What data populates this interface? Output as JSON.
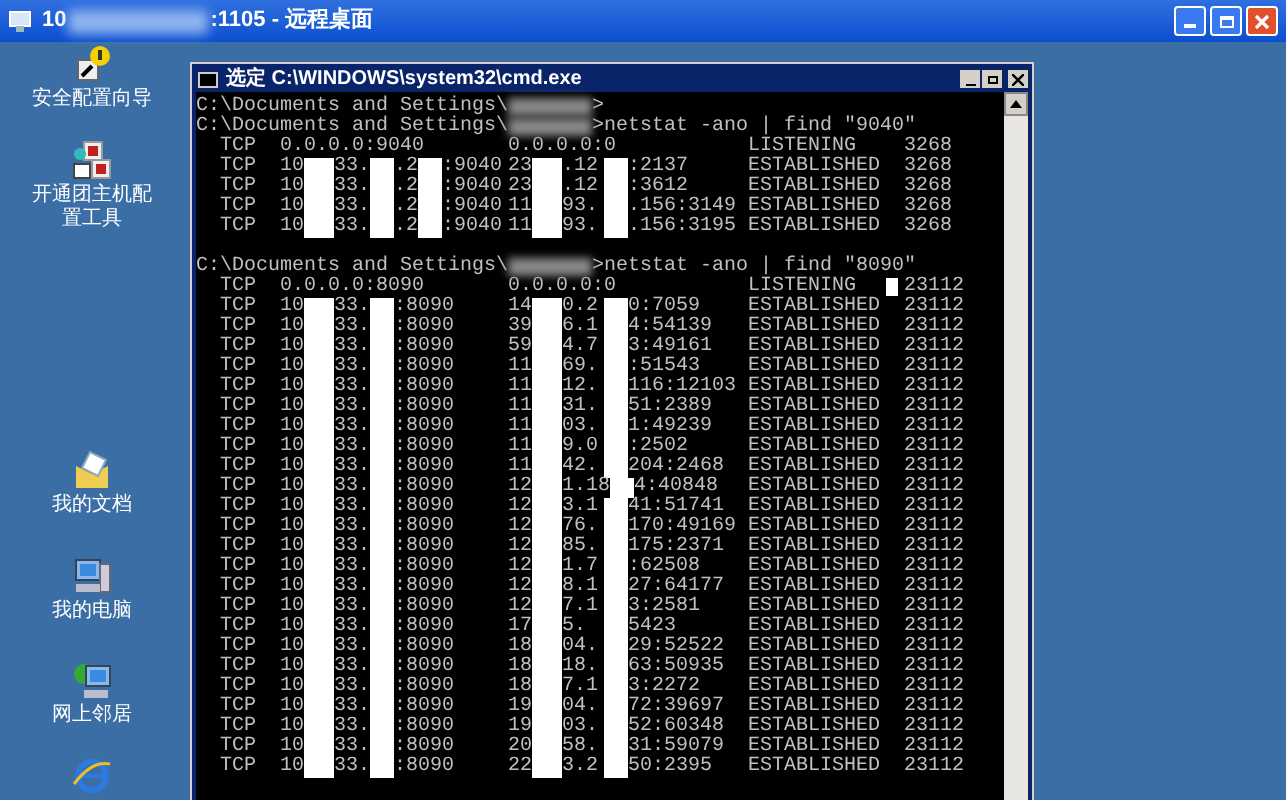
{
  "remote_window": {
    "title_segments": [
      "10",
      ":1105 - 远程桌面"
    ]
  },
  "desktop_icons": [
    {
      "kind": "wizard",
      "label_lines": [
        "安全配置向导"
      ]
    },
    {
      "kind": "tool",
      "label_lines": [
        "开通团主机配",
        "置工具"
      ]
    },
    {
      "kind": "documents",
      "label_lines": [
        "我的文档"
      ]
    },
    {
      "kind": "computer",
      "label_lines": [
        "我的电脑"
      ]
    },
    {
      "kind": "network",
      "label_lines": [
        "网上邻居"
      ]
    },
    {
      "kind": "browser"
    }
  ],
  "console": {
    "title_prefix": "选定",
    "title": "C:\\WINDOWS\\system32\\cmd.exe",
    "sections": [
      {
        "prompt_lines": [
          [
            "C:\\Documents and Settings\\",
            ">"
          ],
          [
            "C:\\Documents and Settings\\",
            ">netstat -ano | find \"9040\""
          ]
        ],
        "rows": [
          {
            "proto": "TCP",
            "local": [
              "0.0.0.0:9040"
            ],
            "foreign": [
              "0.0.0.0:0"
            ],
            "state": "LISTENING",
            "pid": "3268",
            "cursor": false
          },
          {
            "proto": "TCP",
            "local": [
              "10",
              "33.",
              ".2",
              ":9040"
            ],
            "foreign": [
              "23",
              ".12",
              ":2137"
            ],
            "state": "ESTABLISHED",
            "pid": "3268",
            "cursor": false
          },
          {
            "proto": "TCP",
            "local": [
              "10",
              "33.",
              ".2",
              ":9040"
            ],
            "foreign": [
              "23",
              ".12",
              ":3612"
            ],
            "state": "ESTABLISHED",
            "pid": "3268",
            "cursor": false
          },
          {
            "proto": "TCP",
            "local": [
              "10",
              "33.",
              ".2",
              ":9040"
            ],
            "foreign": [
              "11",
              "93.",
              ".156:3149"
            ],
            "state": "ESTABLISHED",
            "pid": "3268",
            "cursor": false
          },
          {
            "proto": "TCP",
            "local": [
              "10",
              "33.",
              ".2",
              ":9040"
            ],
            "foreign": [
              "11",
              "93.",
              ".156:3195"
            ],
            "state": "ESTABLISHED",
            "pid": "3268",
            "cursor": false
          }
        ]
      },
      {
        "prompt_lines": [
          [
            "C:\\Documents and Settings\\",
            ">netstat -ano | find \"8090\""
          ]
        ],
        "rows": [
          {
            "proto": "TCP",
            "local": [
              "0.0.0.0:8090"
            ],
            "foreign": [
              "0.0.0.0:0"
            ],
            "state": "LISTENING",
            "pid": "23112",
            "cursor": true
          },
          {
            "proto": "TCP",
            "local": [
              "10",
              "33.",
              ":8090"
            ],
            "foreign": [
              "14",
              "0.2",
              "0:7059"
            ],
            "state": "ESTABLISHED",
            "pid": "23112",
            "cursor": false
          },
          {
            "proto": "TCP",
            "local": [
              "10",
              "33.",
              ":8090"
            ],
            "foreign": [
              "39",
              "6.1",
              "4:54139"
            ],
            "state": "ESTABLISHED",
            "pid": "23112",
            "cursor": false
          },
          {
            "proto": "TCP",
            "local": [
              "10",
              "33.",
              ":8090"
            ],
            "foreign": [
              "59",
              "4.7",
              "3:49161"
            ],
            "state": "ESTABLISHED",
            "pid": "23112",
            "cursor": false
          },
          {
            "proto": "TCP",
            "local": [
              "10",
              "33.",
              ":8090"
            ],
            "foreign": [
              "11",
              "69.",
              ":51543"
            ],
            "state": "ESTABLISHED",
            "pid": "23112",
            "cursor": false
          },
          {
            "proto": "TCP",
            "local": [
              "10",
              "33.",
              ":8090"
            ],
            "foreign": [
              "11",
              "12.",
              "116:12103"
            ],
            "state": "ESTABLISHED",
            "pid": "23112",
            "cursor": false
          },
          {
            "proto": "TCP",
            "local": [
              "10",
              "33.",
              ":8090"
            ],
            "foreign": [
              "11",
              "31.",
              "51:2389"
            ],
            "state": "ESTABLISHED",
            "pid": "23112",
            "cursor": false
          },
          {
            "proto": "TCP",
            "local": [
              "10",
              "33.",
              ":8090"
            ],
            "foreign": [
              "11",
              "03.",
              "1:49239"
            ],
            "state": "ESTABLISHED",
            "pid": "23112",
            "cursor": false
          },
          {
            "proto": "TCP",
            "local": [
              "10",
              "33.",
              ":8090"
            ],
            "foreign": [
              "11",
              "9.0",
              ":2502"
            ],
            "state": "ESTABLISHED",
            "pid": "23112",
            "cursor": false
          },
          {
            "proto": "TCP",
            "local": [
              "10",
              "33.",
              ":8090"
            ],
            "foreign": [
              "11",
              "42.",
              "204:2468"
            ],
            "state": "ESTABLISHED",
            "pid": "23112",
            "cursor": false
          },
          {
            "proto": "TCP",
            "local": [
              "10",
              "33.",
              ":8090"
            ],
            "foreign": [
              "12",
              "1.18",
              "4:40848"
            ],
            "state": "ESTABLISHED",
            "pid": "23112",
            "cursor": false
          },
          {
            "proto": "TCP",
            "local": [
              "10",
              "33.",
              ":8090"
            ],
            "foreign": [
              "12",
              "3.1",
              "41:51741"
            ],
            "state": "ESTABLISHED",
            "pid": "23112",
            "cursor": false
          },
          {
            "proto": "TCP",
            "local": [
              "10",
              "33.",
              ":8090"
            ],
            "foreign": [
              "12",
              "76.",
              "170:49169"
            ],
            "state": "ESTABLISHED",
            "pid": "23112",
            "cursor": false
          },
          {
            "proto": "TCP",
            "local": [
              "10",
              "33.",
              ":8090"
            ],
            "foreign": [
              "12",
              "85.",
              "175:2371"
            ],
            "state": "ESTABLISHED",
            "pid": "23112",
            "cursor": false
          },
          {
            "proto": "TCP",
            "local": [
              "10",
              "33.",
              ":8090"
            ],
            "foreign": [
              "12",
              "1.7",
              ":62508"
            ],
            "state": "ESTABLISHED",
            "pid": "23112",
            "cursor": false
          },
          {
            "proto": "TCP",
            "local": [
              "10",
              "33.",
              ":8090"
            ],
            "foreign": [
              "12",
              "8.1",
              "27:64177"
            ],
            "state": "ESTABLISHED",
            "pid": "23112",
            "cursor": false
          },
          {
            "proto": "TCP",
            "local": [
              "10",
              "33.",
              ":8090"
            ],
            "foreign": [
              "12",
              "7.1",
              "3:2581"
            ],
            "state": "ESTABLISHED",
            "pid": "23112",
            "cursor": false
          },
          {
            "proto": "TCP",
            "local": [
              "10",
              "33.",
              ":8090"
            ],
            "foreign": [
              "17",
              "5.",
              "5423"
            ],
            "state": "ESTABLISHED",
            "pid": "23112",
            "cursor": false
          },
          {
            "proto": "TCP",
            "local": [
              "10",
              "33.",
              ":8090"
            ],
            "foreign": [
              "18",
              "04.",
              "29:52522"
            ],
            "state": "ESTABLISHED",
            "pid": "23112",
            "cursor": false
          },
          {
            "proto": "TCP",
            "local": [
              "10",
              "33.",
              ":8090"
            ],
            "foreign": [
              "18",
              "18.",
              "63:50935"
            ],
            "state": "ESTABLISHED",
            "pid": "23112",
            "cursor": false
          },
          {
            "proto": "TCP",
            "local": [
              "10",
              "33.",
              ":8090"
            ],
            "foreign": [
              "18",
              "7.1",
              "3:2272"
            ],
            "state": "ESTABLISHED",
            "pid": "23112",
            "cursor": false
          },
          {
            "proto": "TCP",
            "local": [
              "10",
              "33.",
              ":8090"
            ],
            "foreign": [
              "19",
              "04.",
              "72:39697"
            ],
            "state": "ESTABLISHED",
            "pid": "23112",
            "cursor": false
          },
          {
            "proto": "TCP",
            "local": [
              "10",
              "33.",
              ":8090"
            ],
            "foreign": [
              "19",
              "03.",
              "52:60348"
            ],
            "state": "ESTABLISHED",
            "pid": "23112",
            "cursor": false
          },
          {
            "proto": "TCP",
            "local": [
              "10",
              "33.",
              ":8090"
            ],
            "foreign": [
              "20",
              "58.",
              "31:59079"
            ],
            "state": "ESTABLISHED",
            "pid": "23112",
            "cursor": false
          },
          {
            "proto": "TCP",
            "local": [
              "10",
              "33.",
              ":8090"
            ],
            "foreign": [
              "22",
              "3.2",
              "50:2395"
            ],
            "state": "ESTABLISHED",
            "pid": "23112",
            "cursor": false
          }
        ]
      }
    ]
  }
}
